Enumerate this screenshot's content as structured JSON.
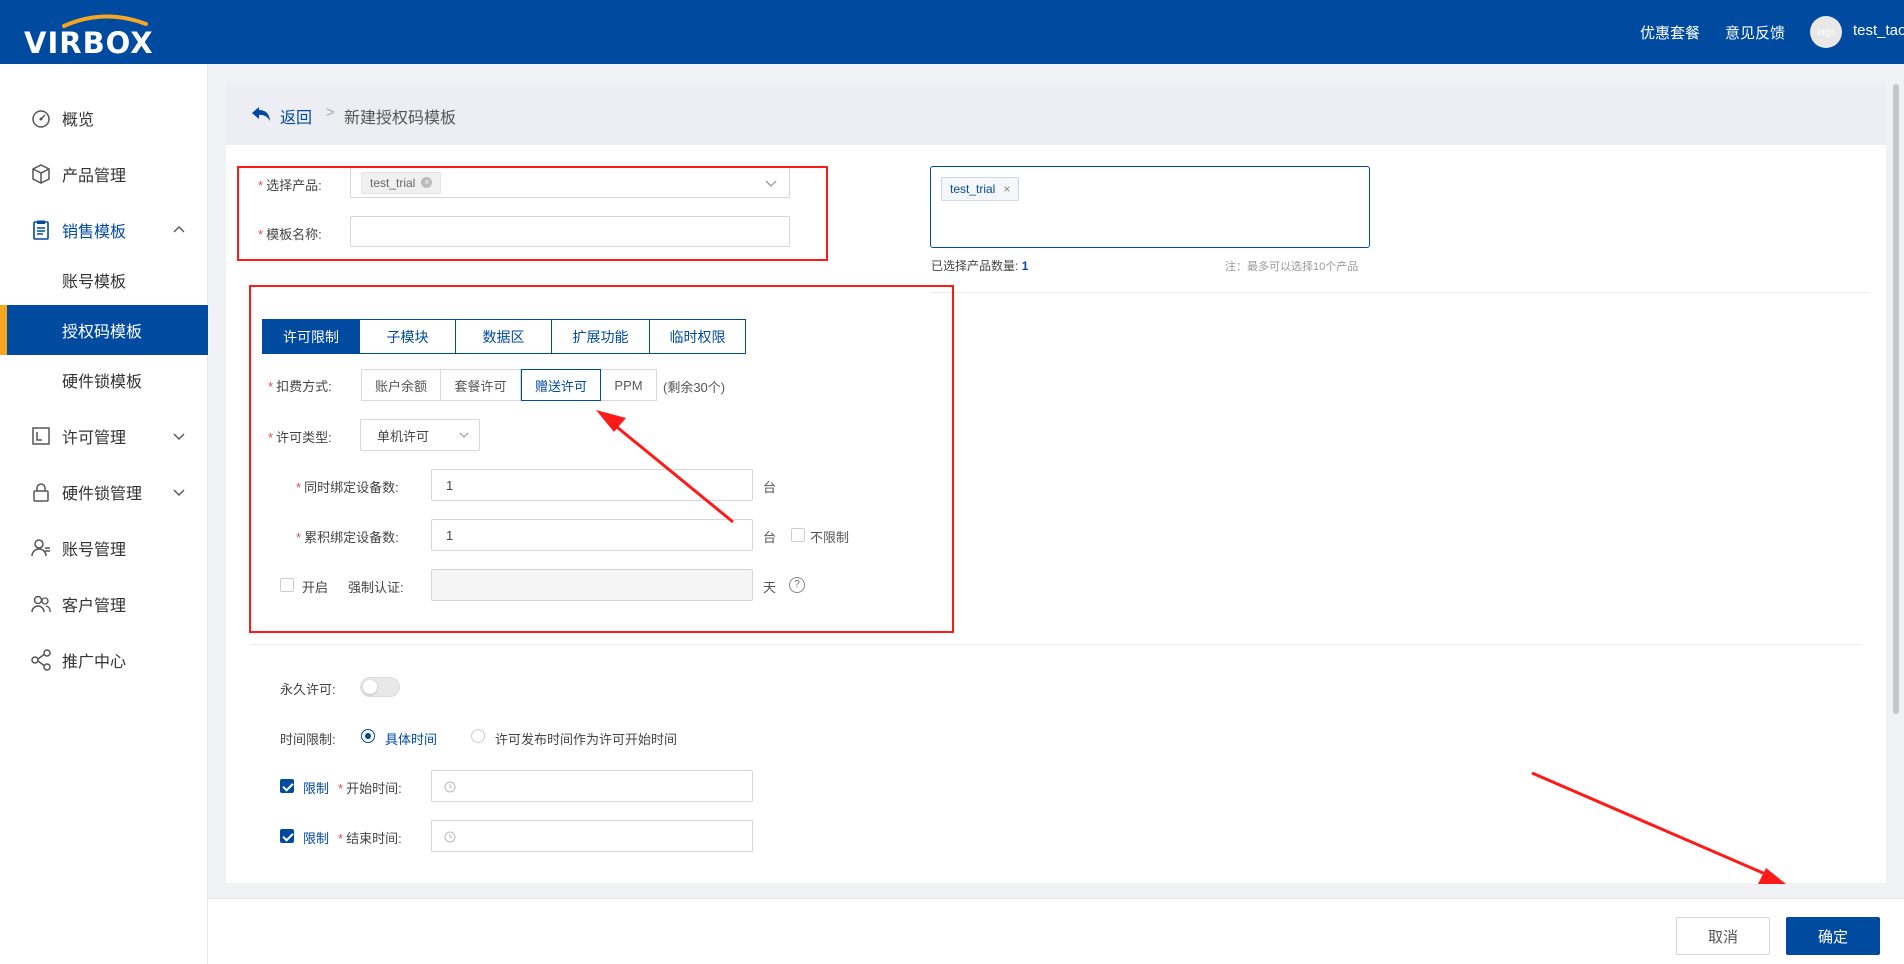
{
  "topbar": {
    "logo_text": "VIRBOX",
    "links": [
      "优惠套餐",
      "意见反馈"
    ],
    "avatar_text": "logo",
    "username": "test_tao"
  },
  "sidebar": {
    "items": [
      {
        "label": "概览",
        "icon": "dashboard-icon"
      },
      {
        "label": "产品管理",
        "icon": "cube-icon"
      },
      {
        "label": "销售模板",
        "icon": "clipboard-icon"
      },
      {
        "label": "许可管理",
        "icon": "license-icon"
      },
      {
        "label": "硬件锁管理",
        "icon": "lock-icon"
      },
      {
        "label": "账号管理",
        "icon": "user-icon"
      },
      {
        "label": "客户管理",
        "icon": "users-icon"
      },
      {
        "label": "推广中心",
        "icon": "share-icon"
      }
    ],
    "sub_items": [
      "账号模板",
      "授权码模板",
      "硬件锁模板"
    ],
    "active_sub": "授权码模板"
  },
  "breadcrumb": {
    "back": "返回",
    "separator": ">",
    "current": "新建授权码模板"
  },
  "product": {
    "label": "选择产品:",
    "tag": "test_trial",
    "name_label": "模板名称:",
    "name_value": "",
    "selected_tag": "test_trial",
    "selected_count_label": "已选择产品数量:",
    "selected_count": "1",
    "note": "注：最多可以选择10个产品"
  },
  "tabs": [
    "许可限制",
    "子模块",
    "数据区",
    "扩展功能",
    "临时权限"
  ],
  "license": {
    "billing_label": "扣费方式:",
    "billing_options": [
      "账户余额",
      "套餐许可",
      "赠送许可",
      "PPM"
    ],
    "billing_selected": "赠送许可",
    "billing_remaining": "(剩余30个)",
    "type_label": "许可类型:",
    "type_value": "单机许可",
    "concurrent_label": "同时绑定设备数:",
    "concurrent_value": "1",
    "concurrent_unit": "台",
    "cumulative_label": "累积绑定设备数:",
    "cumulative_value": "1",
    "cumulative_unit": "台",
    "unlimited_label": "不限制",
    "enable_label": "开启",
    "force_auth_label": "强制认证:",
    "force_auth_unit": "天",
    "help_glyph": "?"
  },
  "time": {
    "permanent_label": "永久许可:",
    "limit_label": "时间限制:",
    "radio_options": [
      "具体时间",
      "许可发布时间作为许可开始时间"
    ],
    "radio_selected": "具体时间",
    "limit_check_label": "限制",
    "start_label": "开始时间:",
    "end_label": "结束时间:"
  },
  "footer": {
    "cancel": "取消",
    "confirm": "确定"
  },
  "colors": {
    "brand": "#004a9f",
    "accent": "#f5a623",
    "annotation": "#ff1a1a"
  }
}
